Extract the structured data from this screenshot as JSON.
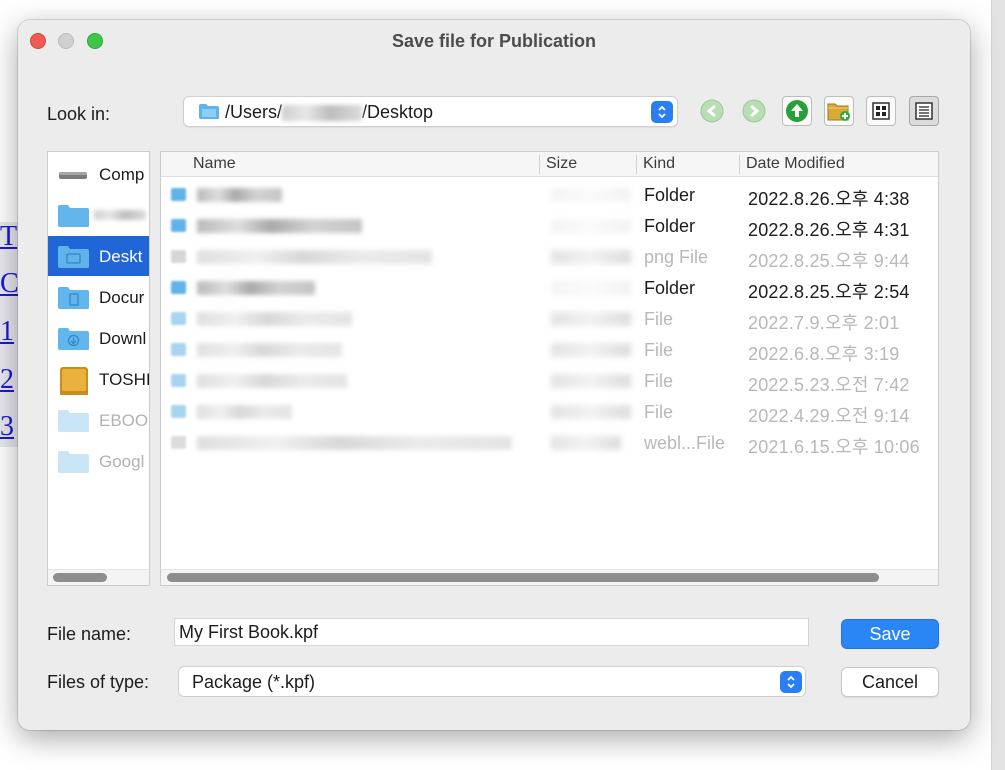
{
  "background": {
    "links": [
      "T",
      "C",
      "1",
      "2",
      "3"
    ]
  },
  "dialog": {
    "title": "Save file for Publication",
    "look_in_label": "Look in:",
    "path": {
      "prefix": "/Users/",
      "suffix": "/Desktop"
    },
    "toolbar": [
      "back-icon",
      "forward-icon",
      "up-folder-icon",
      "new-folder-icon",
      "icon-view-icon",
      "list-view-icon"
    ],
    "sidebar": [
      {
        "label": "Comp",
        "icon": "hard-drive-icon"
      },
      {
        "label": "",
        "icon": "folder-icon"
      },
      {
        "label": "Deskt",
        "icon": "desktop-folder-icon",
        "selected": true
      },
      {
        "label": "Docur",
        "icon": "documents-folder-icon"
      },
      {
        "label": "Downl",
        "icon": "downloads-folder-icon"
      },
      {
        "label": "TOSHI",
        "icon": "external-drive-icon"
      },
      {
        "label": "EBOO",
        "icon": "folder-icon",
        "dim": true
      },
      {
        "label": "Googl",
        "icon": "folder-icon",
        "dim": true
      }
    ],
    "columns": {
      "name": "Name",
      "size": "Size",
      "kind": "Kind",
      "date": "Date Modified"
    },
    "files": [
      {
        "kind": "Folder",
        "date": "2022.8.26.오후 4:38",
        "dim": false
      },
      {
        "kind": "Folder",
        "date": "2022.8.26.오후 4:31",
        "dim": false
      },
      {
        "kind": "png File",
        "date": "2022.8.25.오후 9:44",
        "dim": true
      },
      {
        "kind": "Folder",
        "date": "2022.8.25.오후 2:54",
        "dim": false
      },
      {
        "kind": "File",
        "date": "2022.7.9.오후 2:01",
        "dim": true
      },
      {
        "kind": "File",
        "date": "2022.6.8.오후 3:19",
        "dim": true
      },
      {
        "kind": "File",
        "date": "2022.5.23.오전 7:42",
        "dim": true
      },
      {
        "kind": "File",
        "date": "2022.4.29.오전 9:14",
        "dim": true
      },
      {
        "kind": "webl...File",
        "date": "2021.6.15.오후 10:06",
        "dim": true
      }
    ],
    "file_name_label": "File name:",
    "file_name_value": "My First Book.kpf",
    "file_type_label": "Files of type:",
    "file_type_value": "Package (*.kpf)",
    "save_label": "Save",
    "cancel_label": "Cancel",
    "colors": {
      "accent": "#2a85f5",
      "selection": "#2166d6",
      "folder": "#5fb3ea"
    }
  }
}
